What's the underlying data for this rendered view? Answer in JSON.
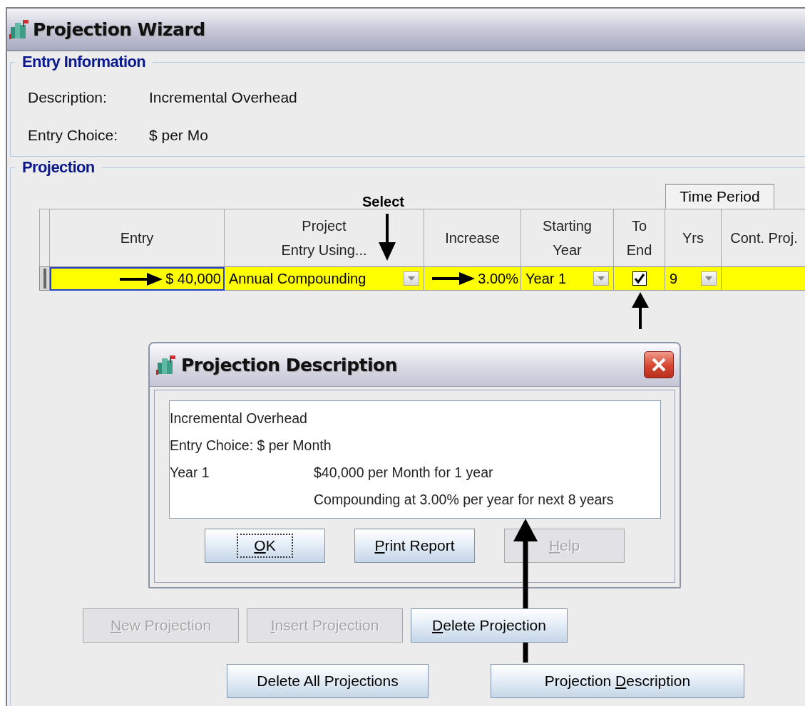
{
  "window": {
    "title": "Projection Wizard"
  },
  "entry_information": {
    "title": "Entry Information",
    "fields": [
      {
        "label": "Description:",
        "value": "Incremental Overhead"
      },
      {
        "label": "Entry Choice:",
        "value": "$ per Mo"
      }
    ]
  },
  "projection": {
    "title": "Projection",
    "annotation_label": "Select",
    "header_group": "Time Period",
    "columns": [
      {
        "lines": [
          "Entry"
        ]
      },
      {
        "lines": [
          "Project",
          "Entry Using..."
        ]
      },
      {
        "lines": [
          "Increase"
        ]
      },
      {
        "lines": [
          "Starting",
          "Year"
        ]
      },
      {
        "lines": [
          "To",
          "End"
        ]
      },
      {
        "lines": [
          "Yrs"
        ]
      },
      {
        "lines": [
          "Cont. Proj."
        ]
      }
    ],
    "rows": [
      {
        "cells": [
          {
            "kind": "amount",
            "text": "$ 40,000",
            "focused": true,
            "arrow": true
          },
          {
            "kind": "dropdown",
            "text": "Annual Compounding"
          },
          {
            "kind": "amount",
            "text": "3.00%",
            "focused": false,
            "arrow": true
          },
          {
            "kind": "dropdown",
            "text": "Year 1"
          },
          {
            "kind": "checkbox",
            "checked": true
          },
          {
            "kind": "dropdown",
            "text": "9"
          },
          {
            "kind": "blank"
          }
        ]
      }
    ],
    "buttons": [
      {
        "key": "N",
        "post": "ew Projection",
        "disabled": true
      },
      {
        "key": "I",
        "post": "nsert Projection",
        "disabled": true
      },
      {
        "key": "D",
        "post": "elete Projection",
        "disabled": false
      },
      {
        "pre": "Delete All Projections",
        "disabled": false
      },
      {
        "pre": "Projection ",
        "key": "D",
        "post": "escription",
        "disabled": false
      }
    ]
  },
  "dialog": {
    "title": "Projection Description",
    "lines": [
      {
        "left": "Incremental Overhead"
      },
      {
        "left": "Entry Choice: $ per Month"
      },
      {
        "left": "Year 1",
        "right": "$40,000 per Month for 1 year"
      },
      {
        "right": "Compounding at 3.00% per year for next 8 years"
      }
    ],
    "buttons": [
      {
        "key": "O",
        "post": "K",
        "disabled": false,
        "focused": true
      },
      {
        "key": "P",
        "post": "rint Report",
        "disabled": false,
        "focused": false
      },
      {
        "key": "H",
        "post": "elp",
        "disabled": true,
        "focused": false
      }
    ]
  }
}
